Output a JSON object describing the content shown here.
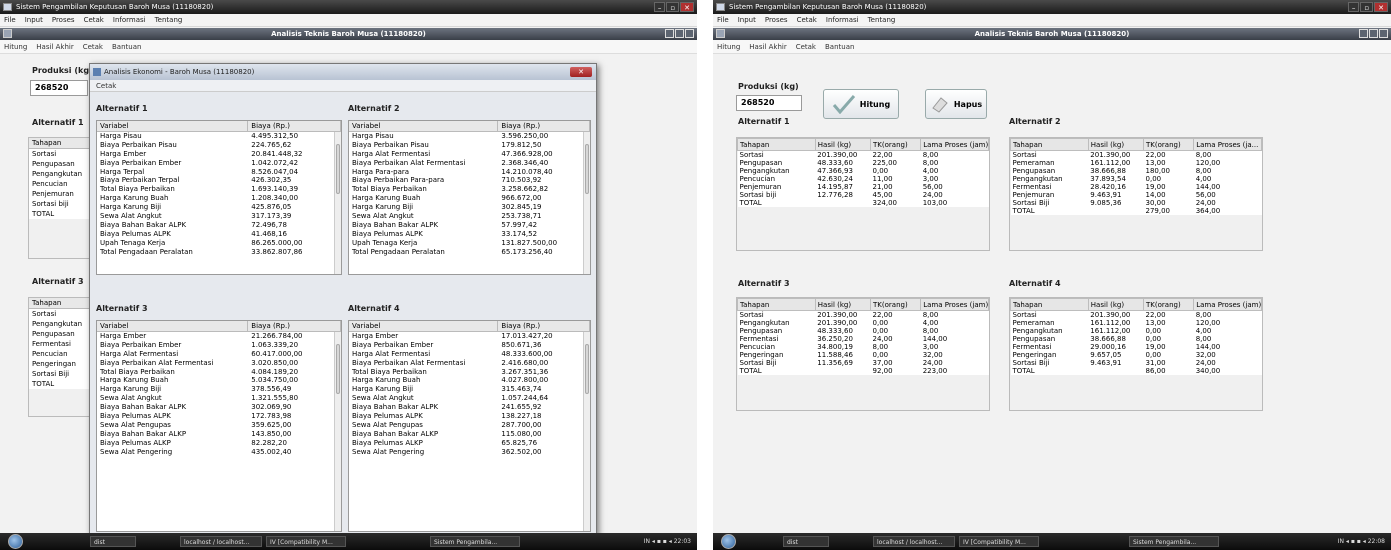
{
  "app_title": "Sistem Pengambilan Keputusan Baroh Musa (11180820)",
  "menu": [
    "File",
    "Input",
    "Proses",
    "Cetak",
    "Informasi",
    "Tentang"
  ],
  "frame_title": "Analisis Teknis Baroh Musa (11180820)",
  "submenu": [
    "Hitung",
    "Hasil Akhir",
    "Cetak",
    "Bantuan"
  ],
  "produksi_label": "Produksi (kg)",
  "produksi_value": "268520",
  "hitung_label": "Hitung",
  "hapus_label": "Hapus",
  "taskbar": {
    "items": [
      "dist",
      "localhost / localhost...",
      "IV [Compatibility M...",
      "Sistem Pengambila..."
    ],
    "lang": "IN",
    "clock_left": "22:03",
    "clock_right": "22:08"
  },
  "left": {
    "behind_labels": [
      "Alternatif 1",
      "Alternatif 3"
    ],
    "behind_list1": [
      "Tahapan",
      "Sortasi",
      "Pengupasan",
      "Pengangkutan",
      "Pencucian",
      "Penjemuran",
      "Sortasi biji",
      "TOTAL"
    ],
    "behind_list3": [
      "Tahapan",
      "Sortasi",
      "Pengangkutan",
      "Pengupasan",
      "Fermentasi",
      "Pencucian",
      "Pengeringan",
      "Sortasi Biji",
      "TOTAL"
    ],
    "dialog_title": "Analisis Ekonomi - Baroh Musa (11180820)",
    "dialog_menu": "Cetak",
    "col_var": "Variabel",
    "col_biaya": "Biaya (Rp.)",
    "alt1": {
      "title": "Alternatif 1",
      "rows": [
        [
          "Harga Pisau",
          "4.495.312,50"
        ],
        [
          "Biaya Perbaikan Pisau",
          "224.765,62"
        ],
        [
          "Harga Ember",
          "20.841.448,32"
        ],
        [
          "Biaya Perbaikan Ember",
          "1.042.072,42"
        ],
        [
          "Harga Terpal",
          "8.526.047,04"
        ],
        [
          "Biaya Perbaikan Terpal",
          "426.302,35"
        ],
        [
          "Total Biaya Perbaikan",
          "1.693.140,39"
        ],
        [
          "Harga Karung Buah",
          "1.208.340,00"
        ],
        [
          "Harga Karung Biji",
          "425.876,05"
        ],
        [
          "Sewa Alat Angkut",
          "317.173,39"
        ],
        [
          "Biaya Bahan Bakar ALPK",
          "72.496,78"
        ],
        [
          "Biaya Pelumas ALPK",
          "41.468,16"
        ],
        [
          "Upah Tenaga Kerja",
          "86.265.000,00"
        ],
        [
          "Total Pengadaan Peralatan",
          "33.862.807,86"
        ]
      ]
    },
    "alt2": {
      "title": "Alternatif 2",
      "rows": [
        [
          "Harga Pisau",
          "3.596.250,00"
        ],
        [
          "Biaya Perbaikan Pisau",
          "179.812,50"
        ],
        [
          "Harga Alat Fermentasi",
          "47.366.928,00"
        ],
        [
          "Biaya Perbaikan Alat Fermentasi",
          "2.368.346,40"
        ],
        [
          "Harga Para-para",
          "14.210.078,40"
        ],
        [
          "Biaya Perbaikan Para-para",
          "710.503,92"
        ],
        [
          "Total Biaya Perbaikan",
          "3.258.662,82"
        ],
        [
          "Harga Karung Buah",
          "966.672,00"
        ],
        [
          "Harga Karung Biji",
          "302.845,19"
        ],
        [
          "Sewa Alat Angkut",
          "253.738,71"
        ],
        [
          "Biaya Bahan Bakar ALPK",
          "57.997,42"
        ],
        [
          "Biaya Pelumas ALPK",
          "33.174,52"
        ],
        [
          "Upah Tenaga Kerja",
          "131.827.500,00"
        ],
        [
          "Total Pengadaan Peralatan",
          "65.173.256,40"
        ]
      ]
    },
    "alt3": {
      "title": "Alternatif 3",
      "rows": [
        [
          "Harga Ember",
          "21.266.784,00"
        ],
        [
          "Biaya Perbaikan Ember",
          "1.063.339,20"
        ],
        [
          "Harga Alat Fermentasi",
          "60.417.000,00"
        ],
        [
          "Biaya Perbaikan Alat Fermentasi",
          "3.020.850,00"
        ],
        [
          "Total Biaya Perbaikan",
          "4.084.189,20"
        ],
        [
          "Harga Karung Buah",
          "5.034.750,00"
        ],
        [
          "Harga Karung Biji",
          "378.556,49"
        ],
        [
          "Sewa Alat Angkut",
          "1.321.555,80"
        ],
        [
          "Biaya Bahan Bakar ALPK",
          "302.069,90"
        ],
        [
          "Biaya Pelumas ALPK",
          "172.783,98"
        ],
        [
          "Sewa Alat Pengupas",
          "359.625,00"
        ],
        [
          "Biaya Bahan Bakar ALKP",
          "143.850,00"
        ],
        [
          "Biaya Pelumas ALKP",
          "82.282,20"
        ],
        [
          "Sewa Alat Pengering",
          "435.002,40"
        ]
      ]
    },
    "alt4": {
      "title": "Alternatif 4",
      "rows": [
        [
          "Harga Ember",
          "17.013.427,20"
        ],
        [
          "Biaya Perbaikan Ember",
          "850.671,36"
        ],
        [
          "Harga Alat Fermentasi",
          "48.333.600,00"
        ],
        [
          "Biaya Perbaikan Alat Fermentasi",
          "2.416.680,00"
        ],
        [
          "Total Biaya Perbaikan",
          "3.267.351,36"
        ],
        [
          "Harga Karung Buah",
          "4.027.800,00"
        ],
        [
          "Harga Karung Biji",
          "315.463,74"
        ],
        [
          "Sewa Alat Angkut",
          "1.057.244,64"
        ],
        [
          "Biaya Bahan Bakar ALPK",
          "241.655,92"
        ],
        [
          "Biaya Pelumas ALPK",
          "138.227,18"
        ],
        [
          "Sewa Alat Pengupas",
          "287.700,00"
        ],
        [
          "Biaya Bahan Bakar ALKP",
          "115.080,00"
        ],
        [
          "Biaya Pelumas ALKP",
          "65.825,76"
        ],
        [
          "Sewa Alat Pengering",
          "362.502,00"
        ]
      ]
    }
  },
  "right": {
    "headers": [
      "Tahapan",
      "Hasil (kg)",
      "TK(orang)",
      "Lama Proses (jam)"
    ],
    "headers_alt2": [
      "Tahapan",
      "Hasil (kg)",
      "TK(orang)",
      "Lama Proses (ja..."
    ],
    "alt1": {
      "title": "Alternatif 1",
      "rows": [
        [
          "Sortasi",
          "201.390,00",
          "22,00",
          "8,00"
        ],
        [
          "Pengupasan",
          "48.333,60",
          "225,00",
          "8,00"
        ],
        [
          "Pengangkutan",
          "47.366,93",
          "0,00",
          "4,00"
        ],
        [
          "Pencucian",
          "42.630,24",
          "11,00",
          "3,00"
        ],
        [
          "Penjemuran",
          "14.195,87",
          "21,00",
          "56,00"
        ],
        [
          "Sortasi biji",
          "12.776,28",
          "45,00",
          "24,00"
        ],
        [
          "TOTAL",
          "",
          "324,00",
          "103,00"
        ]
      ]
    },
    "alt2": {
      "title": "Alternatif 2",
      "rows": [
        [
          "Sortasi",
          "201.390,00",
          "22,00",
          "8,00"
        ],
        [
          "Pemeraman",
          "161.112,00",
          "13,00",
          "120,00"
        ],
        [
          "Pengupasan",
          "38.666,88",
          "180,00",
          "8,00"
        ],
        [
          "Pengangkutan",
          "37.893,54",
          "0,00",
          "4,00"
        ],
        [
          "Fermentasi",
          "28.420,16",
          "19,00",
          "144,00"
        ],
        [
          "Penjemuran",
          "9.463,91",
          "14,00",
          "56,00"
        ],
        [
          "Sortasi Biji",
          "9.085,36",
          "30,00",
          "24,00"
        ],
        [
          "TOTAL",
          "",
          "279,00",
          "364,00"
        ]
      ]
    },
    "alt3": {
      "title": "Alternatif 3",
      "rows": [
        [
          "Sortasi",
          "201.390,00",
          "22,00",
          "8,00"
        ],
        [
          "Pengangkutan",
          "201.390,00",
          "0,00",
          "4,00"
        ],
        [
          "Pengupasan",
          "48.333,60",
          "0,00",
          "8,00"
        ],
        [
          "Fermentasi",
          "36.250,20",
          "24,00",
          "144,00"
        ],
        [
          "Pencucian",
          "34.800,19",
          "8,00",
          "3,00"
        ],
        [
          "Pengeringan",
          "11.588,46",
          "0,00",
          "32,00"
        ],
        [
          "Sortasi Biji",
          "11.356,69",
          "37,00",
          "24,00"
        ],
        [
          "TOTAL",
          "",
          "92,00",
          "223,00"
        ]
      ]
    },
    "alt4": {
      "title": "Alternatif 4",
      "rows": [
        [
          "Sortasi",
          "201.390,00",
          "22,00",
          "8,00"
        ],
        [
          "Pemeraman",
          "161.112,00",
          "13,00",
          "120,00"
        ],
        [
          "Pengangkutan",
          "161.112,00",
          "0,00",
          "4,00"
        ],
        [
          "Pengupasan",
          "38.666,88",
          "0,00",
          "8,00"
        ],
        [
          "Fermentasi",
          "29.000,16",
          "19,00",
          "144,00"
        ],
        [
          "Pengeringan",
          "9.657,05",
          "0,00",
          "32,00"
        ],
        [
          "Sortasi Biji",
          "9.463,91",
          "31,00",
          "24,00"
        ],
        [
          "TOTAL",
          "",
          "86,00",
          "340,00"
        ]
      ]
    }
  }
}
